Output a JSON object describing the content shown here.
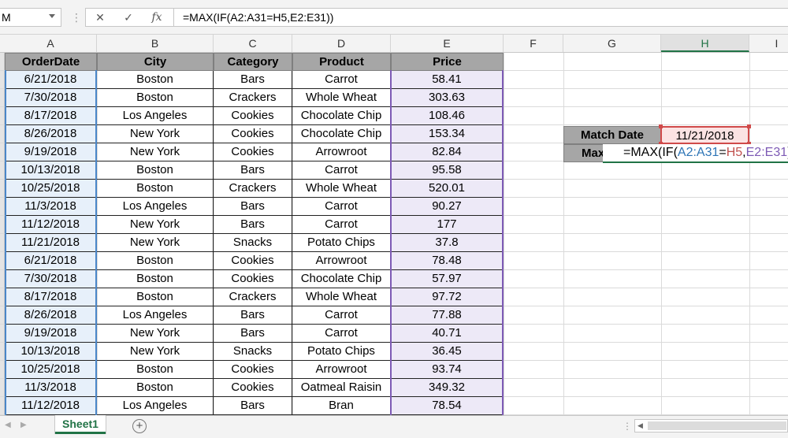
{
  "formula_bar": {
    "name_box": "M",
    "cancel_icon": "✕",
    "enter_icon": "✓",
    "fx_icon": "fx",
    "formula": "=MAX(IF(A2:A31=H5,E2:E31))"
  },
  "columns": [
    "A",
    "B",
    "C",
    "D",
    "E",
    "F",
    "G",
    "H",
    "I"
  ],
  "table": {
    "headers": [
      "OrderDate",
      "City",
      "Category",
      "Product",
      "Price"
    ],
    "rows": [
      [
        "6/21/2018",
        "Boston",
        "Bars",
        "Carrot",
        "58.41"
      ],
      [
        "7/30/2018",
        "Boston",
        "Crackers",
        "Whole Wheat",
        "303.63"
      ],
      [
        "8/17/2018",
        "Los Angeles",
        "Cookies",
        "Chocolate Chip",
        "108.46"
      ],
      [
        "8/26/2018",
        "New York",
        "Cookies",
        "Chocolate Chip",
        "153.34"
      ],
      [
        "9/19/2018",
        "New York",
        "Cookies",
        "Arrowroot",
        "82.84"
      ],
      [
        "10/13/2018",
        "Boston",
        "Bars",
        "Carrot",
        "95.58"
      ],
      [
        "10/25/2018",
        "Boston",
        "Crackers",
        "Whole Wheat",
        "520.01"
      ],
      [
        "11/3/2018",
        "Los Angeles",
        "Bars",
        "Carrot",
        "90.27"
      ],
      [
        "11/12/2018",
        "New York",
        "Bars",
        "Carrot",
        "177"
      ],
      [
        "11/21/2018",
        "New York",
        "Snacks",
        "Potato Chips",
        "37.8"
      ],
      [
        "6/21/2018",
        "Boston",
        "Cookies",
        "Arrowroot",
        "78.48"
      ],
      [
        "7/30/2018",
        "Boston",
        "Cookies",
        "Chocolate Chip",
        "57.97"
      ],
      [
        "8/17/2018",
        "Boston",
        "Crackers",
        "Whole Wheat",
        "97.72"
      ],
      [
        "8/26/2018",
        "Los Angeles",
        "Bars",
        "Carrot",
        "77.88"
      ],
      [
        "9/19/2018",
        "New York",
        "Bars",
        "Carrot",
        "40.71"
      ],
      [
        "10/13/2018",
        "New York",
        "Snacks",
        "Potato Chips",
        "36.45"
      ],
      [
        "10/25/2018",
        "Boston",
        "Cookies",
        "Arrowroot",
        "93.74"
      ],
      [
        "11/3/2018",
        "Boston",
        "Cookies",
        "Oatmeal Raisin",
        "349.32"
      ],
      [
        "11/12/2018",
        "Los Angeles",
        "Bars",
        "Bran",
        "78.54"
      ]
    ]
  },
  "match": {
    "date_label": "Match Date",
    "date_value": "11/21/2018",
    "max_label": "Max",
    "edit_formula_parts": [
      "=MAX(IF(",
      "A2:A31",
      "=",
      "H5",
      ",",
      "E2:E31",
      "))"
    ]
  },
  "sheet_tabs": {
    "active": "Sheet1",
    "add_label": "+"
  },
  "colors": {
    "excel_green": "#217346",
    "header_gray": "#a6a6a6",
    "ref_blue": "#2e75b6",
    "ref_red": "#c0504d",
    "ref_purple": "#7d5ab5"
  }
}
